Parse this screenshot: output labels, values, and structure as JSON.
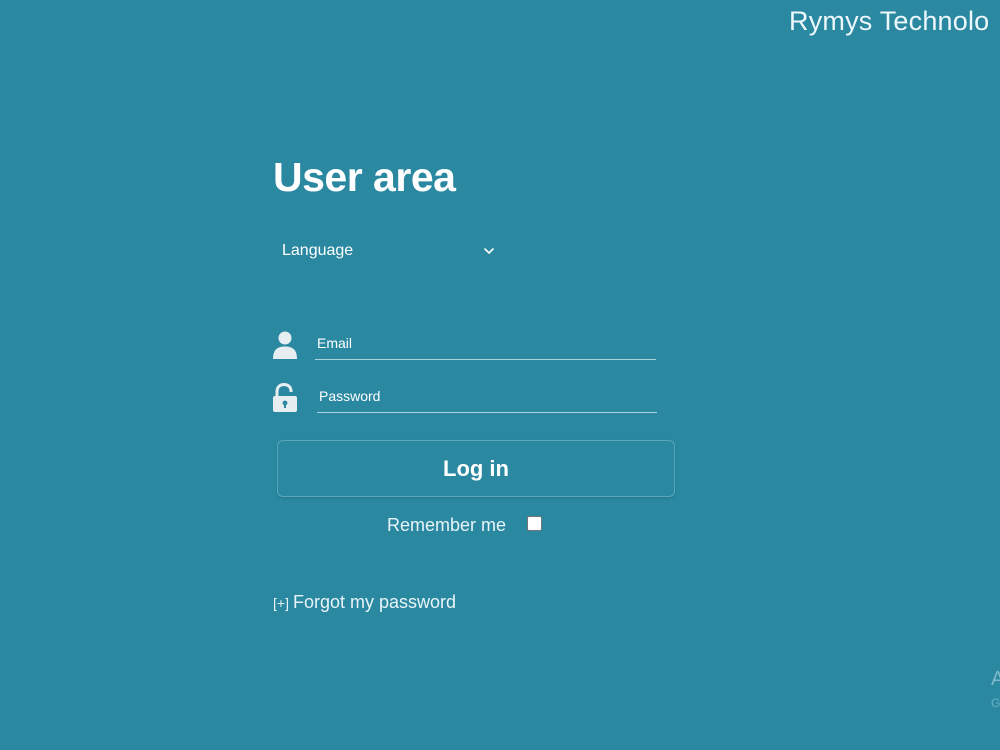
{
  "header": {
    "brand": "Rymys Technolo"
  },
  "main": {
    "title": "User area",
    "language": {
      "selected": "Language"
    },
    "email": {
      "placeholder": "Email",
      "value": ""
    },
    "password": {
      "placeholder": "Password",
      "value": ""
    },
    "login_label": "Log in",
    "remember_label": "Remember me",
    "remember_checked": false,
    "forgot": {
      "prefix": "[+]",
      "label": "Forgot my password"
    }
  },
  "footer": {
    "fragment_large": "A",
    "fragment_small": "G"
  },
  "colors": {
    "background": "#2a88a1",
    "text": "#ffffff",
    "field_underline": "#a9d4df"
  },
  "icons": {
    "language_dropdown": "chevron-down-icon",
    "email": "user-icon",
    "password": "unlock-icon"
  }
}
